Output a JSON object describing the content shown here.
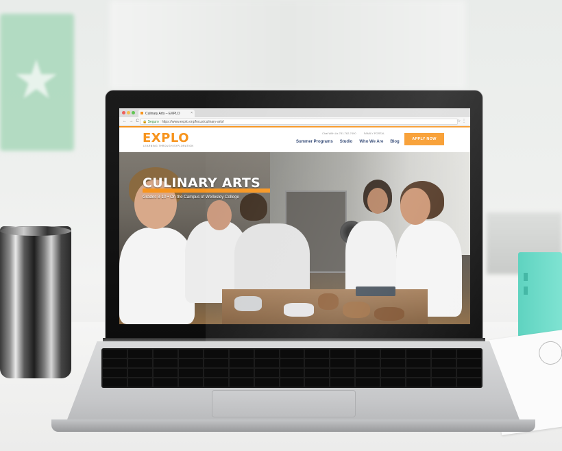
{
  "browser": {
    "tab_title": "Culinary Arts – EXPLO",
    "secure_label": "Seguro",
    "url": "https://www.explo.org/focus/culinary-arts/"
  },
  "site": {
    "logo": "EXPLO",
    "tagline": "LEARNING THROUGH EXPLORATION",
    "utility_links": [
      "Chat With Us 781-762-7400",
      "FAMILY PORTAL"
    ],
    "nav_items": [
      "Summer Programs",
      "Studio",
      "Who We Are",
      "Blog"
    ],
    "apply_button": "APPLY NOW",
    "accent_color": "#f7941d",
    "nav_color": "#223a6a"
  },
  "hero": {
    "title": "CULINARY ARTS",
    "subtitle": "Grades 8-10 • On the Campus of Wellesley College"
  }
}
